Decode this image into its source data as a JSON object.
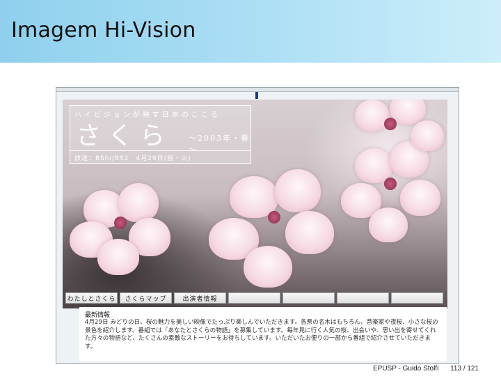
{
  "slide": {
    "title": "Imagem Hi-Vision",
    "footer_source": "EPUSP - Guido Stolfi",
    "page_number": "113 / 121"
  },
  "screenshot": {
    "overlay": {
      "tagline": "ハイビジョンが映す日本のこころ",
      "title": "さくら",
      "subtitle": "～2003年・春～",
      "broadcast": "放送：BShi/BS2　4月29日(祝・火)"
    },
    "nav": {
      "items": [
        "わたしとさくら",
        "さくらマップ",
        "出演者情報",
        "",
        "",
        "",
        ""
      ]
    },
    "news": {
      "heading": "最新情報",
      "body": "4月29日 みどりの日、桜の魅力を美しい映像でたっぷり楽しんでいただきます。各県の名木はもちろん、音楽家や夜桜、小さな桜の景色を紹介します。番組では「あなたとさくらの物語」を募集しています。毎年見に行く人気の桜、出会いや、思い出を寄せてくれた方々の物語など、たくさんの素敵なストーリーをお待ちしています。いただいたお便りの一部から番組で紹介させていただきます。"
    }
  }
}
